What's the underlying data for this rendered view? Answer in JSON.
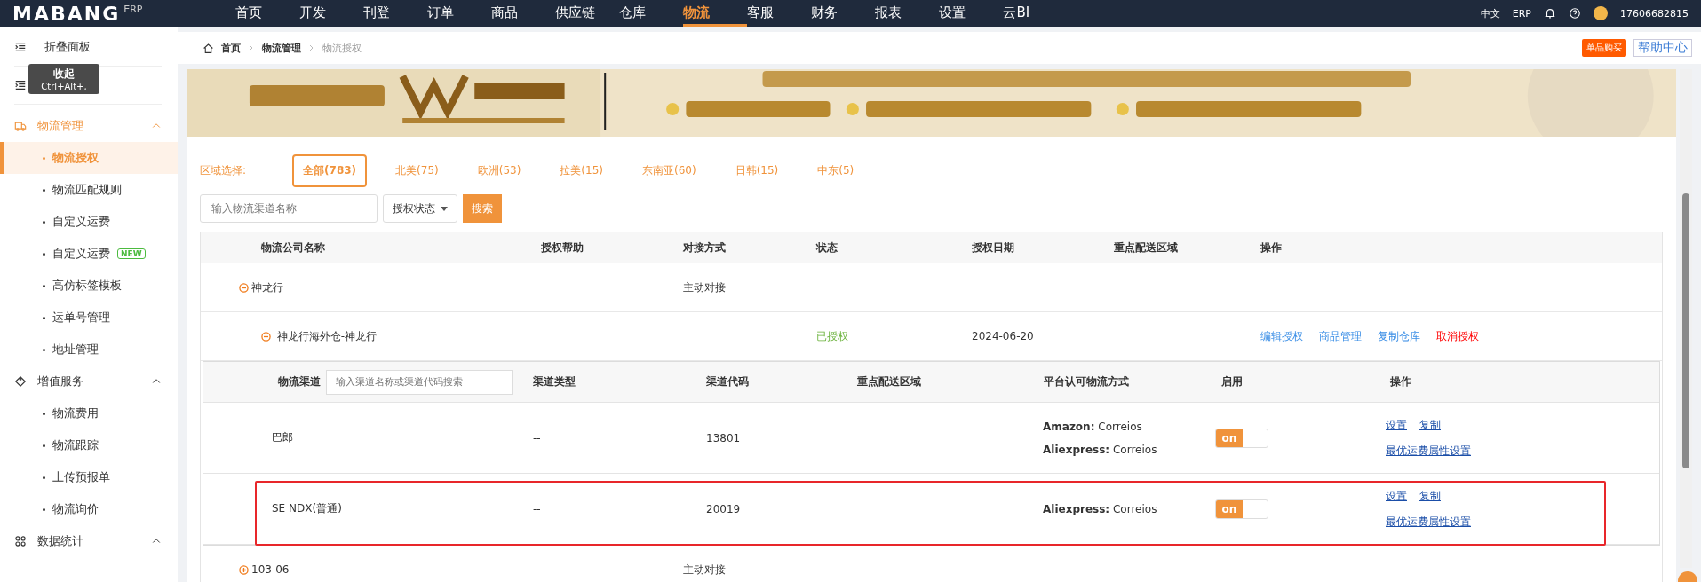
{
  "nav": {
    "logo": "MABANG",
    "logo_sub": "ERP",
    "items": [
      {
        "label": "首页",
        "selected": false
      },
      {
        "label": "开发",
        "selected": false
      },
      {
        "label": "刊登",
        "selected": false
      },
      {
        "label": "订单",
        "selected": false
      },
      {
        "label": "商品",
        "selected": false
      },
      {
        "label": "供应链",
        "selected": false
      },
      {
        "label": "仓库",
        "selected": false
      },
      {
        "label": "物流",
        "selected": true
      },
      {
        "label": "客服",
        "selected": false
      },
      {
        "label": "财务",
        "selected": false
      },
      {
        "label": "报表",
        "selected": false
      },
      {
        "label": "设置",
        "selected": false
      },
      {
        "label": "云BI",
        "selected": false
      }
    ],
    "language": "中文",
    "system": "ERP",
    "user": "17606682815"
  },
  "sidebar": {
    "collapse_label": "折叠面板",
    "tooltip": {
      "title": "收起",
      "shortcut": "Ctrl+Alt+,"
    },
    "groups": [
      {
        "title": "物流管理",
        "expanded": true,
        "active": true,
        "items": [
          {
            "label": "物流授权",
            "selected": true
          },
          {
            "label": "物流匹配规则",
            "selected": false
          },
          {
            "label": "自定义运费",
            "selected": false
          },
          {
            "label": "自定义运费",
            "selected": false,
            "badge": "NEW"
          },
          {
            "label": "高仿标签模板",
            "selected": false
          },
          {
            "label": "运单号管理",
            "selected": false
          },
          {
            "label": "地址管理",
            "selected": false
          }
        ]
      },
      {
        "title": "增值服务",
        "expanded": true,
        "active": false,
        "items": [
          {
            "label": "物流费用",
            "selected": false
          },
          {
            "label": "物流跟踪",
            "selected": false
          },
          {
            "label": "上传预报单",
            "selected": false
          },
          {
            "label": "物流询价",
            "selected": false
          }
        ]
      },
      {
        "title": "数据统计",
        "expanded": true,
        "active": false
      }
    ]
  },
  "breadcrumb": [
    "首页",
    "物流管理",
    "物流授权"
  ],
  "header_buttons": {
    "buy": "单品购买",
    "help": "帮助中心"
  },
  "banner": {
    "kind": "picture"
  },
  "region_filter": {
    "label": "区域选择:",
    "regions": [
      {
        "label": "全部(783)",
        "selected": true
      },
      {
        "label": "北美(75)",
        "selected": false
      },
      {
        "label": "欧洲(53)",
        "selected": false
      },
      {
        "label": "拉美(15)",
        "selected": false
      },
      {
        "label": "东南亚(60)",
        "selected": false
      },
      {
        "label": "日韩(15)",
        "selected": false
      },
      {
        "label": "中东(5)",
        "selected": false
      }
    ]
  },
  "search": {
    "placeholder": "输入物流渠道名称",
    "status_dropdown": "授权状态",
    "button": "搜索"
  },
  "table": {
    "columns": [
      "物流公司名称",
      "授权帮助",
      "对接方式",
      "状态",
      "授权日期",
      "重点配送区域",
      "操作"
    ],
    "companies": [
      {
        "name": "神龙行",
        "expanded": true,
        "mode": "主动对接",
        "warehouses": [
          {
            "name": "神龙行海外仓-神龙行",
            "expanded": true,
            "status": "已授权",
            "date": "2024-06-20",
            "actions": [
              {
                "label": "编辑授权",
                "kind": "link"
              },
              {
                "label": "商品管理",
                "kind": "link"
              },
              {
                "label": "复制仓库",
                "kind": "link"
              },
              {
                "label": "取消授权",
                "kind": "danger"
              }
            ],
            "channels": {
              "filter_label": "物流渠道",
              "placeholder": "输入渠道名称或渠道代码搜索",
              "columns": [
                "渠道类型",
                "渠道代码",
                "重点配送区域",
                "平台认可物流方式",
                "启用",
                "操作"
              ],
              "rows": [
                {
                  "name": "巴郎",
                  "type": "--",
                  "code": "13801",
                  "highlighted": false,
                  "platforms": [
                    {
                      "platform": "Amazon:",
                      "method": "Correios"
                    },
                    {
                      "platform": "Aliexpress:",
                      "method": "Correios"
                    }
                  ],
                  "toggle": "on",
                  "enabled": true,
                  "actions": [
                    "设置",
                    "复制"
                  ],
                  "extra_action": "最优运费属性设置"
                },
                {
                  "name": "SE NDX(普通)",
                  "type": "--",
                  "code": "20019",
                  "highlighted": true,
                  "platforms": [
                    {
                      "platform": "Aliexpress:",
                      "method": "Correios"
                    }
                  ],
                  "toggle": "on",
                  "enabled": true,
                  "actions": [
                    "设置",
                    "复制"
                  ],
                  "extra_action": "最优运费属性设置"
                }
              ]
            }
          }
        ]
      },
      {
        "name": "103-06",
        "expanded": false,
        "mode": "主动对接"
      }
    ]
  }
}
